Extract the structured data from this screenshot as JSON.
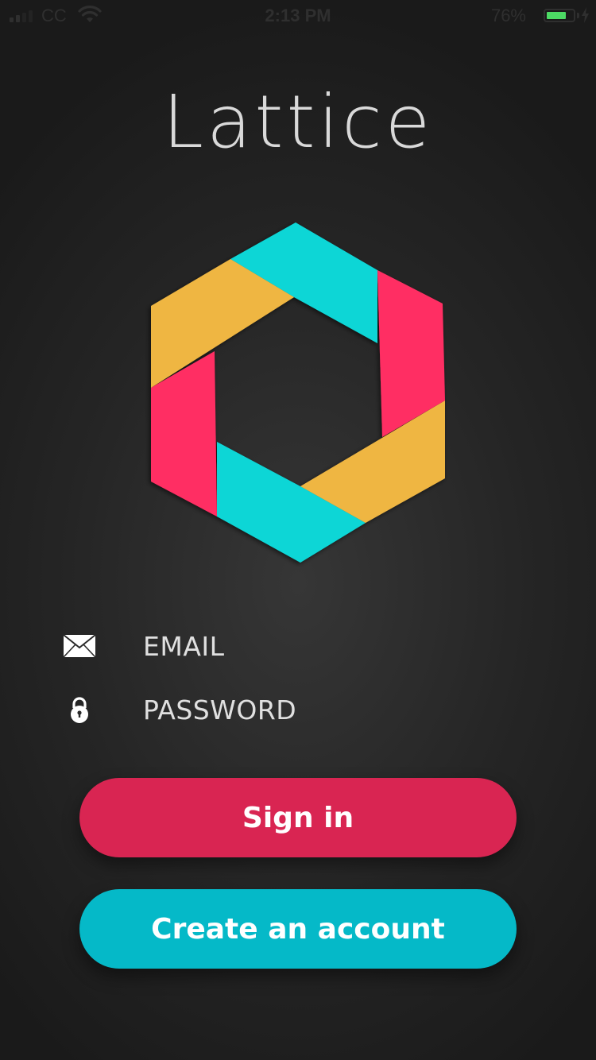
{
  "status_bar": {
    "carrier": "CC",
    "time": "2:13 PM",
    "battery_percent": "76%",
    "battery_level": 0.76,
    "signal_bars": 4,
    "signal_active_bars": 2
  },
  "app": {
    "title": "Lattice"
  },
  "logo": {
    "colors": {
      "cyan": "#0bd6d6",
      "pink": "#ff2e63",
      "yellow": "#efb643"
    }
  },
  "form": {
    "email": {
      "placeholder": "EMAIL",
      "value": "",
      "icon": "envelope-icon"
    },
    "password": {
      "placeholder": "PASSWORD",
      "value": "",
      "icon": "lock-icon"
    }
  },
  "actions": {
    "sign_in_label": "Sign in",
    "create_account_label": "Create an account"
  },
  "colors": {
    "sign_in": "#d92552",
    "create_account": "#05b9c8"
  }
}
